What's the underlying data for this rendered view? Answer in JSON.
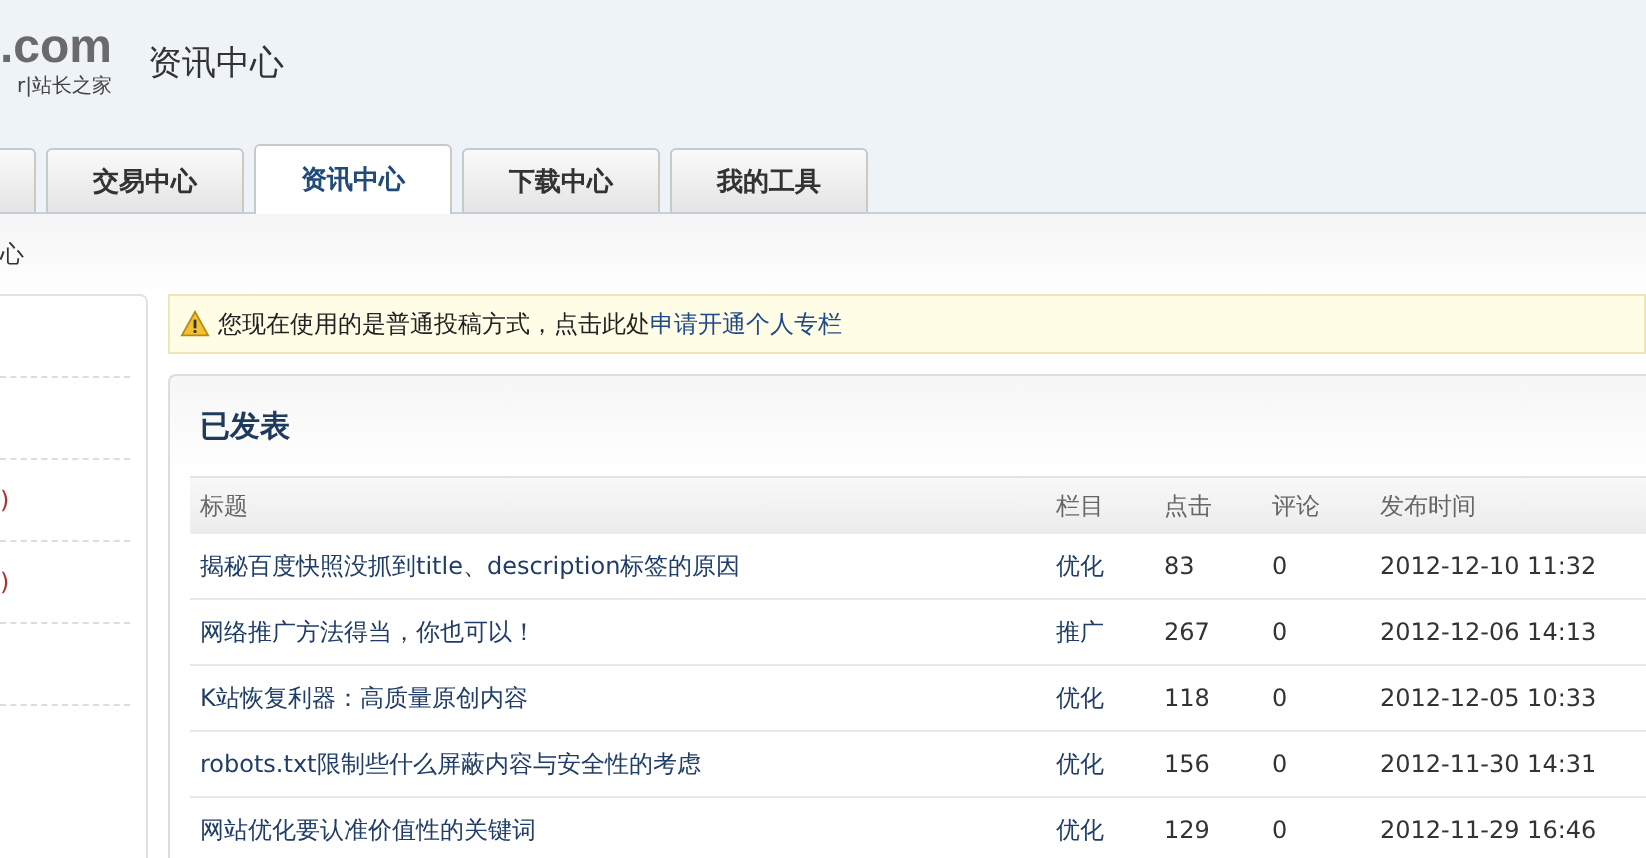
{
  "header": {
    "logo_domain": ".com",
    "logo_tagline": "r|站长之家",
    "section_title": "资讯中心"
  },
  "tabs": [
    {
      "label": "交易中心",
      "selected": false
    },
    {
      "label": "资讯中心",
      "selected": true
    },
    {
      "label": "下载中心",
      "selected": false
    },
    {
      "label": "我的工具",
      "selected": false
    }
  ],
  "breadcrumb": "心",
  "sidebar": {
    "items": [
      {
        "kind": "blank"
      },
      {
        "kind": "blank"
      },
      {
        "kind": "text",
        "label": ")"
      },
      {
        "kind": "text",
        "label": ")"
      },
      {
        "kind": "blank"
      }
    ]
  },
  "notice": {
    "text": "您现在使用的是普通投稿方式，点击此处",
    "link": "申请开通个人专栏"
  },
  "panel": {
    "title": "已发表",
    "table": {
      "columns": [
        "标题",
        "栏目",
        "点击",
        "评论",
        "发布时间"
      ],
      "rows": [
        {
          "title": "揭秘百度快照没抓到title、description标签的原因",
          "category": "优化",
          "clicks": "83",
          "comments": "0",
          "time": "2012-12-10 11:32"
        },
        {
          "title": "网络推广方法得当，你也可以！",
          "category": "推广",
          "clicks": "267",
          "comments": "0",
          "time": "2012-12-06 14:13"
        },
        {
          "title": "K站恢复利器：高质量原创内容",
          "category": "优化",
          "clicks": "118",
          "comments": "0",
          "time": "2012-12-05 10:33"
        },
        {
          "title": "robots.txt限制些什么屏蔽内容与安全性的考虑",
          "category": "优化",
          "clicks": "156",
          "comments": "0",
          "time": "2012-11-30 14:31"
        },
        {
          "title": "网站优化要认准价值性的关键词",
          "category": "优化",
          "clicks": "129",
          "comments": "0",
          "time": "2012-11-29 16:46"
        }
      ]
    }
  }
}
